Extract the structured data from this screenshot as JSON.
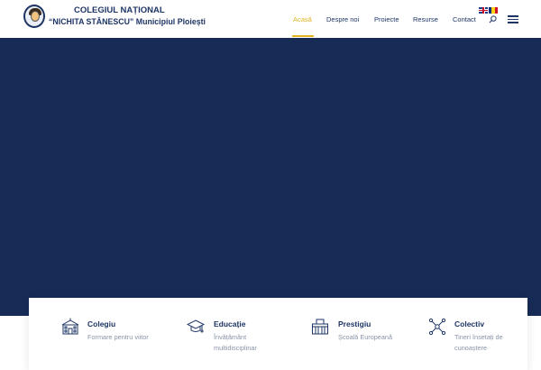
{
  "header": {
    "school_name_line1": "COLEGIUL NAȚIONAL",
    "school_name_line2": "“NICHITA STĂNESCU” Municipiul Ploiești",
    "logo_icon": "school-crest-logo",
    "languages": [
      "English",
      "Română"
    ]
  },
  "nav": {
    "items": [
      {
        "label": "Acasă",
        "active": true
      },
      {
        "label": "Despre noi",
        "active": false
      },
      {
        "label": "Proiecte",
        "active": false
      },
      {
        "label": "Resurse",
        "active": false
      },
      {
        "label": "Contact",
        "active": false
      }
    ],
    "search_icon": "search-icon",
    "menu_icon": "hamburger-menu-icon"
  },
  "hero": {
    "background_color": "#172b57"
  },
  "features": [
    {
      "icon": "school-building-icon",
      "title": "Colegiu",
      "desc": "Formare pentru viitor"
    },
    {
      "icon": "graduation-cap-icon",
      "title": "Educație",
      "desc": "Învățământ multidisciplinar"
    },
    {
      "icon": "european-school-icon",
      "title": "Prestigiu",
      "desc": "Școală Europeană"
    },
    {
      "icon": "network-icon",
      "title": "Colectiv",
      "desc": "Tineri însetați de cunoaștere"
    }
  ],
  "colors": {
    "brand_navy": "#1d3566",
    "accent_gold": "#e0b524",
    "muted_text": "#8a94a6"
  }
}
